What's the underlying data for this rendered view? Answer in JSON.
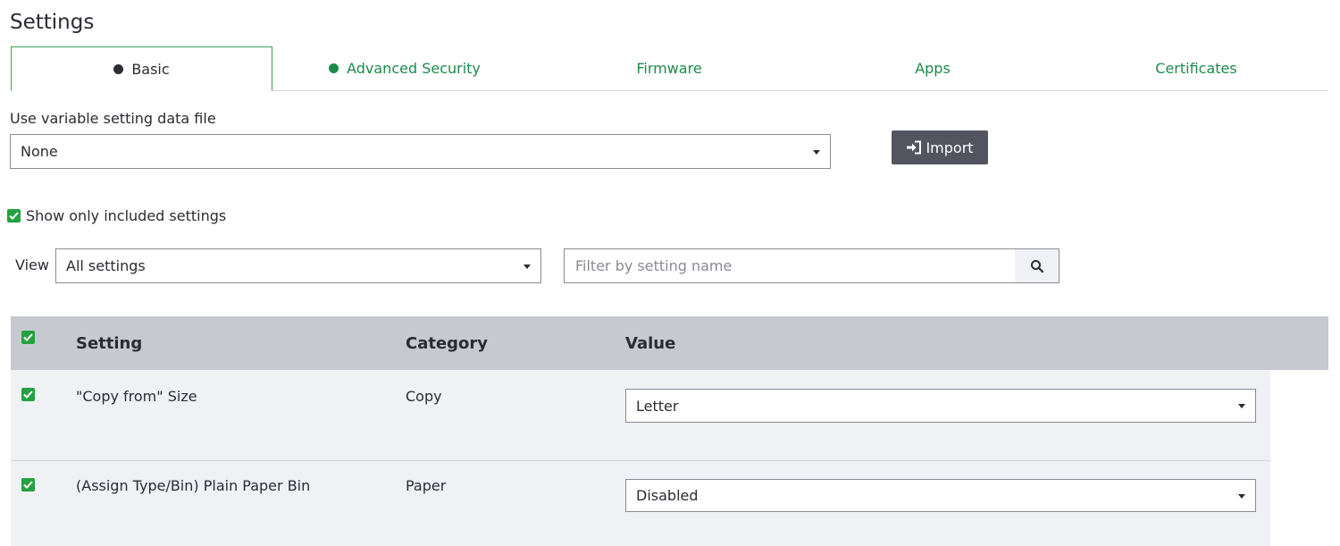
{
  "page": {
    "title": "Settings"
  },
  "tabs": [
    {
      "label": "Basic",
      "active": true,
      "dot_color": "#2b2b33"
    },
    {
      "label": "Advanced Security",
      "active": false,
      "dot_color": "#1e8a4c"
    },
    {
      "label": "Firmware",
      "active": false
    },
    {
      "label": "Apps",
      "active": false
    },
    {
      "label": "Certificates",
      "active": false
    }
  ],
  "variable_file": {
    "label": "Use variable setting data file",
    "selected": "None"
  },
  "import_button": {
    "label": "Import",
    "icon": "import-icon"
  },
  "show_only_included": {
    "label": "Show only included settings",
    "checked": true
  },
  "view": {
    "label": "View",
    "selected": "All settings"
  },
  "filter": {
    "placeholder": "Filter by setting name",
    "icon": "search-icon"
  },
  "table": {
    "columns": [
      "Setting",
      "Category",
      "Value"
    ],
    "rows": [
      {
        "checked": true,
        "setting": "\"Copy from\" Size",
        "category": "Copy",
        "value": "Letter"
      },
      {
        "checked": true,
        "setting": "(Assign Type/Bin) Plain Paper Bin",
        "category": "Paper",
        "value": "Disabled"
      }
    ]
  },
  "colors": {
    "accent_green": "#1e8a4c",
    "checkbox_green": "#23a23f",
    "header_bg": "#c8c9d0",
    "button_dark": "#545460"
  }
}
